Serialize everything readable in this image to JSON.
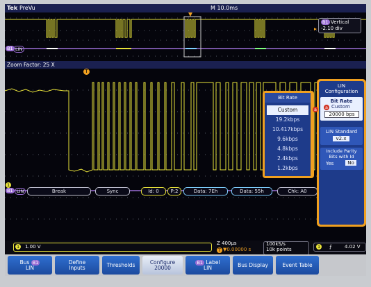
{
  "top": {
    "tek": "Tek",
    "mode": "PreVu",
    "timebase": "M 10.0ms"
  },
  "overview": {
    "vertical_label": "Vertical",
    "vertical_value": "-2.10 div",
    "bus_chip": "LIN",
    "vert_chip": "B1",
    "bus_marker": "B1"
  },
  "zoom": {
    "factor_label": "Zoom Factor: 25 X",
    "trigger_marker": "T",
    "ch1_marker": "1",
    "bus_marker": "B1",
    "bus_chip": "LIN"
  },
  "bus_decode": [
    {
      "label": "Break"
    },
    {
      "label": "Sync"
    },
    {
      "label": "Id: 0"
    },
    {
      "label": "P:2"
    },
    {
      "label": "Data: 7Eh"
    },
    {
      "label": "Data: 55h"
    },
    {
      "label": "Chk: A0"
    }
  ],
  "bitrate_menu": {
    "title": "Bit Rate",
    "items": [
      "Custom",
      "19.2kbps",
      "10.417kbps",
      "9.6kbps",
      "4.8kbps",
      "2.4kbps",
      "1.2kbps"
    ],
    "selected": "Custom"
  },
  "side_panel": {
    "title_line1": "LIN",
    "title_line2": "Configuration",
    "bitrate_label": "Bit Rate",
    "bitrate_knob": "a",
    "bitrate_mode": "Custom",
    "bitrate_value": "20000 bps",
    "standard_label": "LIN Standard",
    "standard_value": "v2.x",
    "parity_line1": "Include Parity",
    "parity_line2": "Bits with Id",
    "parity_yes": "Yes",
    "parity_no": "No",
    "knob_marker": "a"
  },
  "status": {
    "ch1_num": "1",
    "ch1_scale": "1.00 V",
    "horiz_scale": "Z 400µs",
    "horiz_pos_chip": "T",
    "horiz_pos": "▼0.00000 s",
    "sample_rate": "100kS/s",
    "record_len": "10k points",
    "trig_ch": "1",
    "trig_slope": "⨍",
    "trig_level": "4.02 V"
  },
  "buttons": [
    {
      "line1": "Bus",
      "chip": "B1",
      "line2": "LIN"
    },
    {
      "line1": "Define",
      "line2": "Inputs"
    },
    {
      "line1": "Thresholds"
    },
    {
      "line1": "Configure",
      "line2": "20000"
    },
    {
      "chip": "B1",
      "line1": "Label",
      "line2": "LIN"
    },
    {
      "line1": "Bus Display"
    },
    {
      "line1": "Event Table"
    }
  ],
  "colors": {
    "ch1": "#e8e23a",
    "bus": "#9b6fd6",
    "accent": "#f0a020",
    "menu": "#1e3b8a"
  }
}
